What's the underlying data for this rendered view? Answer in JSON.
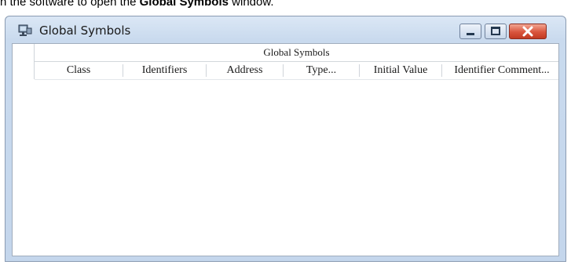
{
  "caption": {
    "prefix": "n the software to open the ",
    "bold": "Global Symbols",
    "suffix": " window."
  },
  "window": {
    "title": "Global Symbols",
    "icon": "network-window-icon",
    "controls": [
      "minimize",
      "maximize",
      "close"
    ]
  },
  "table": {
    "group_header": "Global Symbols",
    "columns": [
      "Class",
      "Identifiers",
      "Address",
      "Type...",
      "Initial Value",
      "Identifier Comment..."
    ],
    "rows": []
  }
}
